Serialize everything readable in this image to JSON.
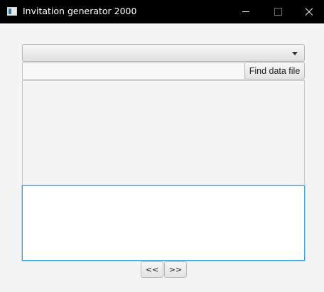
{
  "window": {
    "title": "Invitation generator 2000",
    "titlebar_color": "#000000",
    "background_color": "#f4f4f4"
  },
  "titlebar_buttons": {
    "minimize_icon": "minimize-icon",
    "maximize_icon": "maximize-icon",
    "close_icon": "close-icon"
  },
  "template_select": {
    "selected_value": "",
    "icon": "chevron-down-icon"
  },
  "data_file": {
    "path_value": "",
    "find_button_label": "Find data file"
  },
  "preview": {
    "text": ""
  },
  "editor": {
    "value": "",
    "focus_color": "#3aa4e0"
  },
  "navigation": {
    "prev_label": "<<",
    "next_label": ">>"
  }
}
